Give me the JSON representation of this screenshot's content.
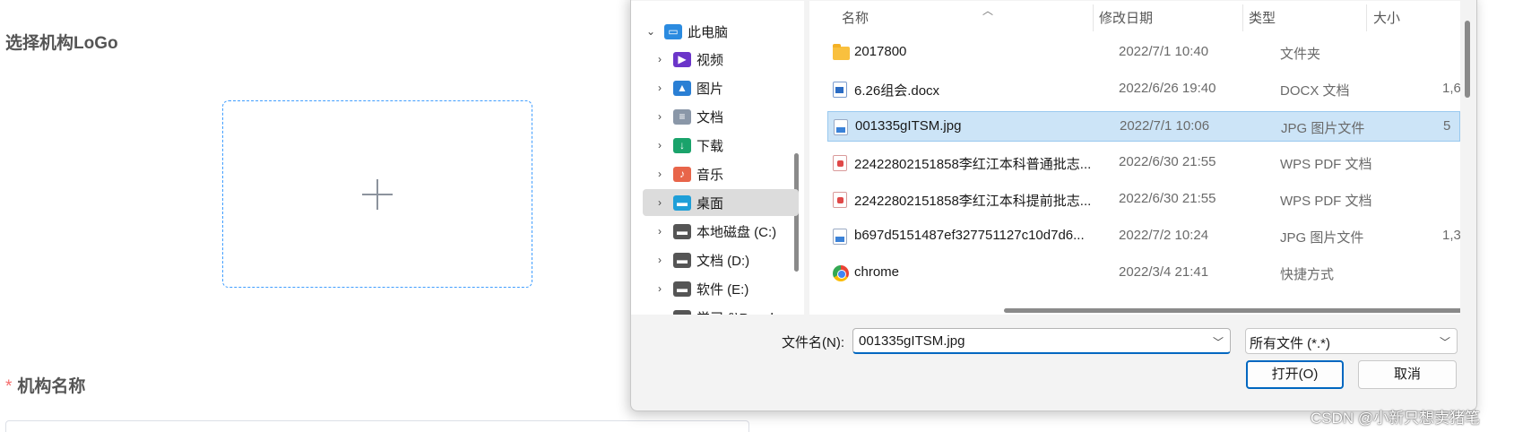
{
  "form": {
    "logo_label": "选择机构LoGo",
    "name_required_mark": "*",
    "name_label": "机构名称"
  },
  "dialog": {
    "nav": {
      "items": [
        {
          "label": "此电脑",
          "icon": "computer-icon",
          "color": "#2b8be0",
          "expanded": true
        },
        {
          "label": "视频",
          "icon": "video-icon",
          "color": "#6b35c9"
        },
        {
          "label": "图片",
          "icon": "picture-icon",
          "color": "#2a7fd4"
        },
        {
          "label": "文档",
          "icon": "document-icon",
          "color": "#8a97a8"
        },
        {
          "label": "下载",
          "icon": "download-icon",
          "color": "#1aa36b"
        },
        {
          "label": "音乐",
          "icon": "music-icon",
          "color": "#e8654a"
        },
        {
          "label": "桌面",
          "icon": "desktop-icon",
          "color": "#1f9fd8",
          "selected": true
        },
        {
          "label": "本地磁盘 (C:)",
          "icon": "drive-icon",
          "color": "#555"
        },
        {
          "label": "文档 (D:)",
          "icon": "drive-icon",
          "color": "#555"
        },
        {
          "label": "软件 (E:)",
          "icon": "drive-icon",
          "color": "#555"
        },
        {
          "label": "学习 (\\\\Raspber",
          "icon": "network-drive-icon",
          "color": "#555"
        }
      ]
    },
    "columns": {
      "name": "名称",
      "date": "修改日期",
      "type": "类型",
      "size": "大小"
    },
    "files": [
      {
        "name": "2017800",
        "date": "2022/7/1 10:40",
        "type": "文件夹",
        "size": "",
        "icon": "folder"
      },
      {
        "name": "6.26组会.docx",
        "date": "2022/6/26 19:40",
        "type": "DOCX 文档",
        "size": "1,6",
        "icon": "doc"
      },
      {
        "name": "001335gITSM.jpg",
        "date": "2022/7/1 10:06",
        "type": "JPG 图片文件",
        "size": "5",
        "icon": "jpg",
        "selected": true
      },
      {
        "name": "22422802151858李红江本科普通批志...",
        "date": "2022/6/30 21:55",
        "type": "WPS PDF 文档",
        "size": "",
        "icon": "pdf"
      },
      {
        "name": "22422802151858李红江本科提前批志...",
        "date": "2022/6/30 21:55",
        "type": "WPS PDF 文档",
        "size": "",
        "icon": "pdf"
      },
      {
        "name": "b697d5151487ef327751127c10d7d6...",
        "date": "2022/7/2 10:24",
        "type": "JPG 图片文件",
        "size": "1,3",
        "icon": "jpg"
      },
      {
        "name": "chrome",
        "date": "2022/3/4 21:41",
        "type": "快捷方式",
        "size": "",
        "icon": "chrome"
      }
    ],
    "filename_label": "文件名(N):",
    "filename_value": "001335gITSM.jpg",
    "filter_value": "所有文件 (*.*)",
    "open_button": "打开(O)",
    "cancel_button": "取消"
  },
  "watermark": "CSDN @小新只想卖猪笔"
}
